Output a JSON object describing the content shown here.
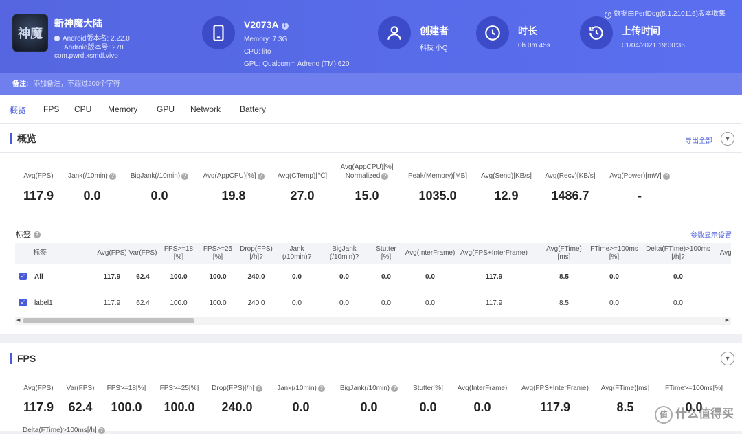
{
  "header": {
    "app": {
      "name": "新神魔大陆",
      "icon": "game-icon",
      "icon_text": "神魔",
      "version_name": "Android版本名: 2.22.0",
      "version_code": "Android版本号: 278",
      "package": "com.pwrd.xsmdl.vivo"
    },
    "device": {
      "model": "V2073A",
      "memory": "Memory: 7.3G",
      "cpu": "CPU: lito",
      "gpu": "GPU: Qualcomm Adreno (TM) 620"
    },
    "creator": {
      "title": "创建者",
      "value": "科技 小Q"
    },
    "duration": {
      "title": "时长",
      "value": "0h 0m 45s"
    },
    "upload": {
      "title": "上传时间",
      "value": "01/04/2021 19:00:36"
    },
    "collector_note": "数据由PerfDog(5.1.210116)版本收集",
    "colors": {
      "accent": "#4a5bd9",
      "header": "#5566e0"
    }
  },
  "note": {
    "label": "备注:",
    "placeholder": "添加备注，不超过200个字符"
  },
  "tabs": [
    "概览",
    "FPS",
    "CPU",
    "Memory",
    "GPU",
    "Network",
    "Battery"
  ],
  "overview": {
    "title": "概览",
    "export_label": "导出全部",
    "stats": [
      {
        "label": "Avg(FPS)",
        "value": "117.9"
      },
      {
        "label": "Jank(/10min)",
        "value": "0.0"
      },
      {
        "label": "BigJank(/10min)",
        "value": "0.0"
      },
      {
        "label": "Avg(AppCPU)[%]",
        "value": "19.8"
      },
      {
        "label": "Avg(CTemp)[℃]",
        "value": "27.0"
      },
      {
        "label": "Avg(AppCPU)[%]",
        "label2": "Normalized",
        "value": "15.0"
      },
      {
        "label": "Peak(Memory)[MB]",
        "value": "1035.0"
      },
      {
        "label": "Avg(Send)[KB/s]",
        "value": "12.9"
      },
      {
        "label": "Avg(Recv)[KB/s]",
        "value": "1486.7"
      },
      {
        "label": "Avg(Power)[mW]",
        "value": "-"
      }
    ],
    "tags_title": "标签",
    "param_settings": "参数显示设置",
    "table": {
      "headers": [
        [
          "标签",
          ""
        ],
        [
          "Avg(FPS)",
          ""
        ],
        [
          "Var(FPS)",
          ""
        ],
        [
          "FPS>=18",
          "[%]"
        ],
        [
          "FPS>=25",
          "[%]"
        ],
        [
          "Drop(FPS)",
          "[/h]"
        ],
        [
          "Jank",
          "(/10min)"
        ],
        [
          "BigJank",
          "(/10min)"
        ],
        [
          "Stutter",
          "[%]"
        ],
        [
          "Avg(InterFrame)",
          ""
        ],
        [
          "Avg(FPS+InterFrame)",
          ""
        ],
        [
          "Avg(FTime)",
          "[ms]"
        ],
        [
          "FTime>=100ms",
          "[%]"
        ],
        [
          "Delta(FTime)>100ms",
          "[/h]"
        ],
        [
          "Avg(",
          ""
        ]
      ],
      "rows": [
        {
          "label": "All",
          "cells": [
            "117.9",
            "62.4",
            "100.0",
            "100.0",
            "240.0",
            "0.0",
            "0.0",
            "0.0",
            "0.0",
            "117.9",
            "8.5",
            "0.0",
            "0.0"
          ]
        },
        {
          "label": "label1",
          "cells": [
            "117.9",
            "62.4",
            "100.0",
            "100.0",
            "240.0",
            "0.0",
            "0.0",
            "0.0",
            "0.0",
            "117.9",
            "8.5",
            "0.0",
            "0.0"
          ]
        }
      ]
    }
  },
  "fps": {
    "title": "FPS",
    "stats": [
      {
        "label": "Avg(FPS)",
        "value": "117.9"
      },
      {
        "label": "Var(FPS)",
        "value": "62.4"
      },
      {
        "label": "FPS>=18[%]",
        "value": "100.0"
      },
      {
        "label": "FPS>=25[%]",
        "value": "100.0"
      },
      {
        "label": "Drop(FPS)[/h]",
        "value": "240.0"
      },
      {
        "label": "Jank(/10min)",
        "value": "0.0"
      },
      {
        "label": "BigJank(/10min)",
        "value": "0.0"
      },
      {
        "label": "Stutter[%]",
        "value": "0.0"
      },
      {
        "label": "Avg(InterFrame)",
        "value": "0.0"
      },
      {
        "label": "Avg(FPS+InterFrame)",
        "value": "117.9"
      },
      {
        "label": "Avg(FTime)[ms]",
        "value": "8.5"
      },
      {
        "label": "FTime>=100ms[%]",
        "value": "0.0"
      }
    ],
    "extra_label": "Delta(FTime)>100ms[/h]"
  },
  "watermark": "什么值得买"
}
